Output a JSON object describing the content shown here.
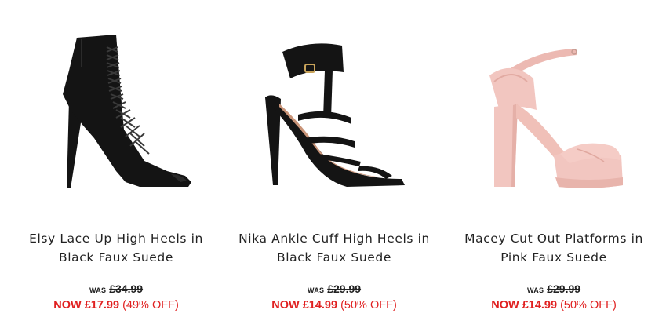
{
  "products": [
    {
      "title_line1": "Elsy Lace Up High Heels in",
      "title_line2": "Black Faux Suede",
      "was_label": "WAS",
      "was_price": "£34.99",
      "now_label": "NOW",
      "now_price": "£17.99",
      "discount": "(49% OFF)",
      "image": "black-lace-up-heel-boot"
    },
    {
      "title_line1": "Nika Ankle Cuff High Heels in",
      "title_line2": "Black Faux Suede",
      "was_label": "WAS",
      "was_price": "£29.99",
      "now_label": "NOW",
      "now_price": "£14.99",
      "discount": "(50% OFF)",
      "image": "black-ankle-cuff-heel"
    },
    {
      "title_line1": "Macey Cut Out Platforms in",
      "title_line2": "Pink Faux Suede",
      "was_label": "WAS",
      "was_price": "£29.99",
      "now_label": "NOW",
      "now_price": "£14.99",
      "discount": "(50% OFF)",
      "image": "pink-platform-heel"
    }
  ],
  "colors": {
    "sale_red": "#e02020",
    "text": "#222222",
    "suede_black": "#141414",
    "suede_pink": "#f2c6c0"
  }
}
